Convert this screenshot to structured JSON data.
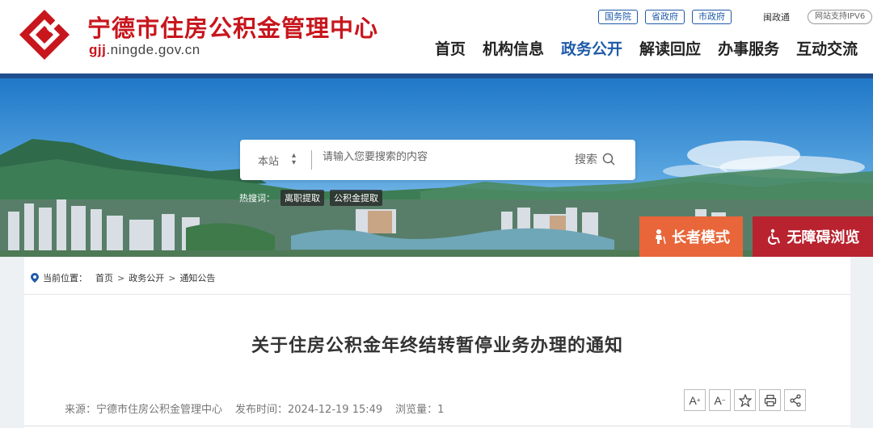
{
  "header": {
    "site_name": "宁德市住房公积金管理中心",
    "url_bold": "gjj",
    "url_rest": ".ningde.gov.cn",
    "top_links": [
      "国务院",
      "省政府",
      "市政府"
    ],
    "minzhengtong": "闽政通",
    "ipv6": "网站支持IPV6",
    "nav": [
      "首页",
      "机构信息",
      "政务公开",
      "解读回应",
      "办事服务",
      "互动交流"
    ],
    "active_nav": "政务公开"
  },
  "search": {
    "scope": "本站",
    "placeholder": "请输入您要搜索的内容",
    "button": "搜索",
    "hot_label": "热搜词：",
    "hot_tags": [
      "离职提取",
      "公积金提取"
    ]
  },
  "accessibility": {
    "elder_mode": "长者模式",
    "barrier_free": "无障碍浏览"
  },
  "breadcrumb": {
    "label": "当前位置：",
    "items": [
      "首页",
      "政务公开",
      "通知公告"
    ]
  },
  "article": {
    "title": "关于住房公积金年终结转暂停业务办理的通知",
    "source": "来源：宁德市住房公积金管理中心",
    "publish_time": "发布时间：2024-12-19 15:49",
    "views": "浏览量：1"
  },
  "colors": {
    "brand_red": "#c8161d",
    "nav_blue": "#1e5aa8",
    "elder_orange": "#e8663a",
    "access_red": "#b8232f"
  }
}
